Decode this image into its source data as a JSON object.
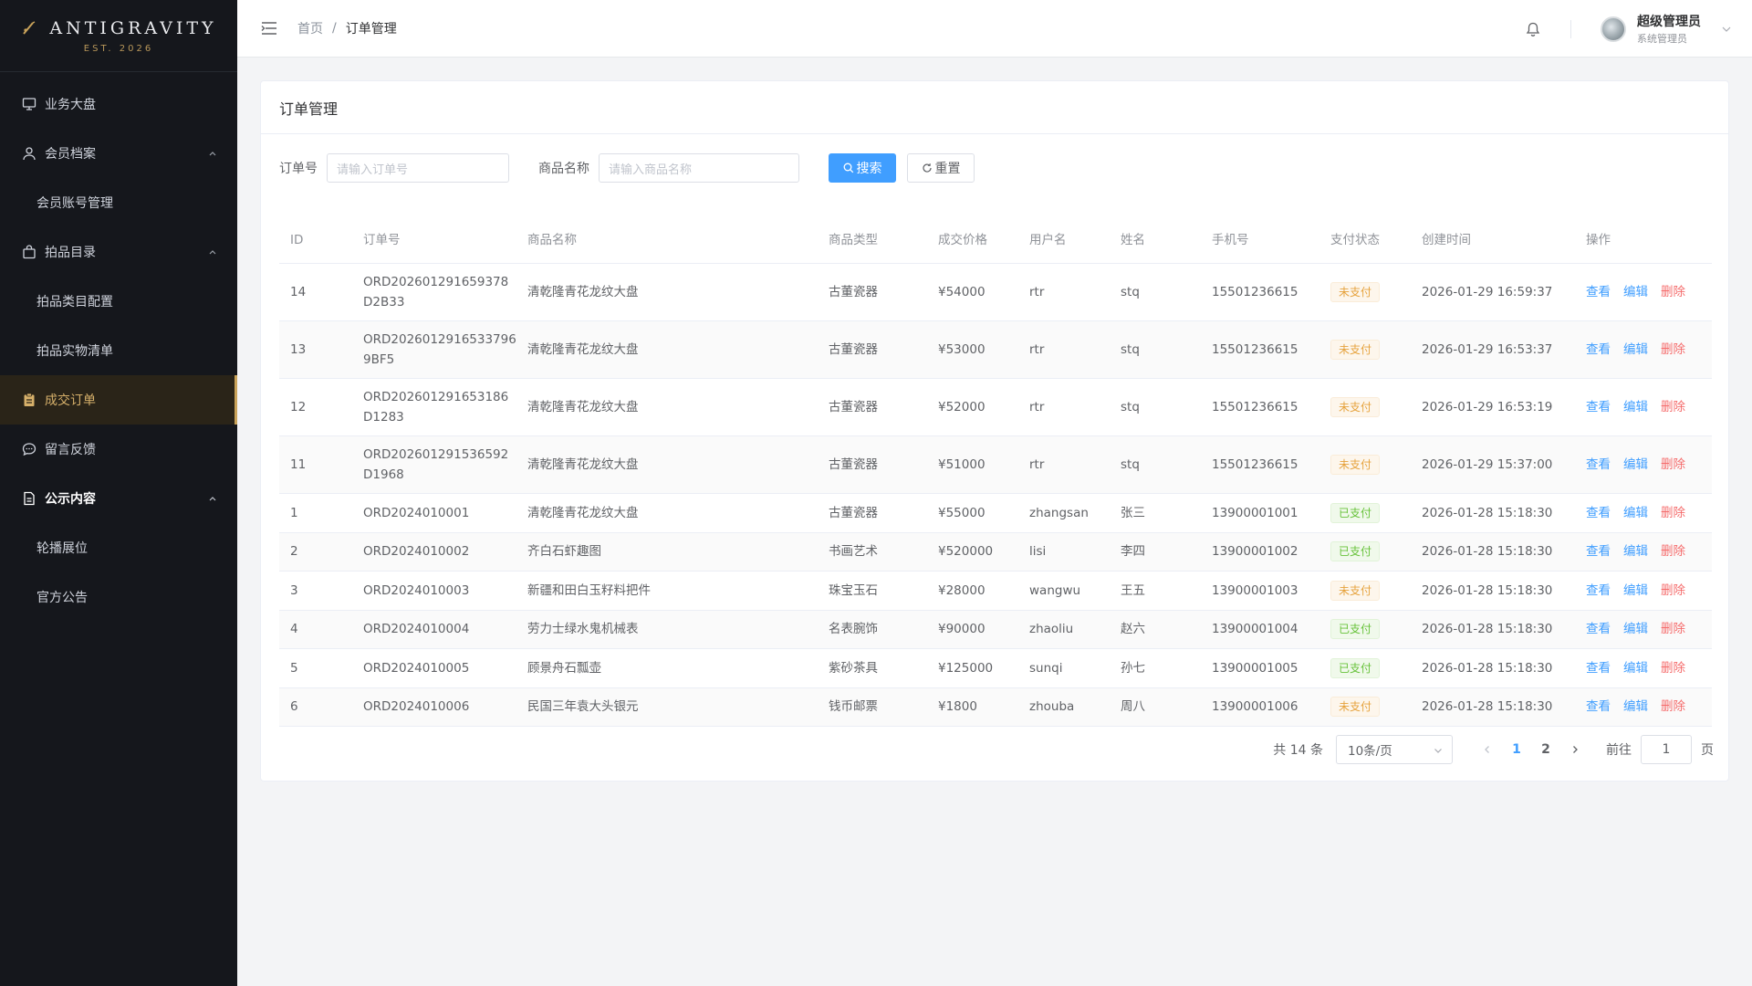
{
  "brand": {
    "name": "ANTIGRAVITY",
    "subtitle": "EST. 2026"
  },
  "sidebar": {
    "items": [
      {
        "label": "业务大盘"
      },
      {
        "label": "会员档案"
      },
      {
        "label": "会员账号管理"
      },
      {
        "label": "拍品目录"
      },
      {
        "label": "拍品类目配置"
      },
      {
        "label": "拍品实物清单"
      },
      {
        "label": "成交订单"
      },
      {
        "label": "留言反馈"
      },
      {
        "label": "公示内容"
      },
      {
        "label": "轮播展位"
      },
      {
        "label": "官方公告"
      }
    ]
  },
  "header": {
    "breadcrumb": {
      "home": "首页",
      "sep": "/",
      "current": "订单管理"
    },
    "user": {
      "name": "超级管理员",
      "role": "系统管理员"
    }
  },
  "card": {
    "title": "订单管理"
  },
  "filters": {
    "order_label": "订单号",
    "order_placeholder": "请输入订单号",
    "product_label": "商品名称",
    "product_placeholder": "请输入商品名称",
    "search_label": "搜索",
    "reset_label": "重置"
  },
  "table": {
    "columns": [
      "ID",
      "订单号",
      "商品名称",
      "商品类型",
      "成交价格",
      "用户名",
      "姓名",
      "手机号",
      "支付状态",
      "创建时间",
      "操作"
    ],
    "ops": {
      "view": "查看",
      "edit": "编辑",
      "delete": "删除"
    },
    "rows": [
      {
        "id": "14",
        "order": "ORD2026012916593 78D2B33",
        "order_display": "ORD202601291659378D2B33",
        "product": "清乾隆青花龙纹大盘",
        "type": "古董瓷器",
        "price": "¥54000",
        "username": "rtr",
        "name": "stq",
        "phone": "15501236615",
        "status": "未支付",
        "paid": false,
        "time": "2026-01-29 16:59:37"
      },
      {
        "id": "13",
        "order": "ORD2026012916533796 9BF5",
        "order_display": "ORD2026012916533796 9BF5",
        "product": "清乾隆青花龙纹大盘",
        "type": "古董瓷器",
        "price": "¥53000",
        "username": "rtr",
        "name": "stq",
        "phone": "15501236615",
        "status": "未支付",
        "paid": false,
        "time": "2026-01-29 16:53:37"
      },
      {
        "id": "12",
        "order": "ORD202601291653186D1283",
        "order_display": "ORD202601291653186D1283",
        "product": "清乾隆青花龙纹大盘",
        "type": "古董瓷器",
        "price": "¥52000",
        "username": "rtr",
        "name": "stq",
        "phone": "15501236615",
        "status": "未支付",
        "paid": false,
        "time": "2026-01-29 16:53:19"
      },
      {
        "id": "11",
        "order": "ORD202601291536592D1968",
        "order_display": "ORD202601291536592D1968",
        "product": "清乾隆青花龙纹大盘",
        "type": "古董瓷器",
        "price": "¥51000",
        "username": "rtr",
        "name": "stq",
        "phone": "15501236615",
        "status": "未支付",
        "paid": false,
        "time": "2026-01-29 15:37:00"
      },
      {
        "id": "1",
        "order_display": "ORD2024010001",
        "product": "清乾隆青花龙纹大盘",
        "type": "古董瓷器",
        "price": "¥55000",
        "username": "zhangsan",
        "name": "张三",
        "phone": "13900001001",
        "status": "已支付",
        "paid": true,
        "time": "2026-01-28 15:18:30"
      },
      {
        "id": "2",
        "order_display": "ORD2024010002",
        "product": "齐白石虾趣图",
        "type": "书画艺术",
        "price": "¥520000",
        "username": "lisi",
        "name": "李四",
        "phone": "13900001002",
        "status": "已支付",
        "paid": true,
        "time": "2026-01-28 15:18:30"
      },
      {
        "id": "3",
        "order_display": "ORD2024010003",
        "product": "新疆和田白玉籽料把件",
        "type": "珠宝玉石",
        "price": "¥28000",
        "username": "wangwu",
        "name": "王五",
        "phone": "13900001003",
        "status": "未支付",
        "paid": false,
        "time": "2026-01-28 15:18:30"
      },
      {
        "id": "4",
        "order_display": "ORD2024010004",
        "product": "劳力士绿水鬼机械表",
        "type": "名表腕饰",
        "price": "¥90000",
        "username": "zhaoliu",
        "name": "赵六",
        "phone": "13900001004",
        "status": "已支付",
        "paid": true,
        "time": "2026-01-28 15:18:30"
      },
      {
        "id": "5",
        "order_display": "ORD2024010005",
        "product": "顾景舟石瓢壶",
        "type": "紫砂茶具",
        "price": "¥125000",
        "username": "sunqi",
        "name": "孙七",
        "phone": "13900001005",
        "status": "已支付",
        "paid": true,
        "time": "2026-01-28 15:18:30"
      },
      {
        "id": "6",
        "order_display": "ORD2024010006",
        "product": "民国三年袁大头银元",
        "type": "钱币邮票",
        "price": "¥1800",
        "username": "zhouba",
        "name": "周八",
        "phone": "13900001006",
        "status": "未支付",
        "paid": false,
        "time": "2026-01-28 15:18:30"
      }
    ]
  },
  "pagination": {
    "total_text": "共 14 条",
    "page_size": "10条/页",
    "pages": [
      "1",
      "2"
    ],
    "current_page": "1",
    "goto_label": "前往",
    "goto_value": "1",
    "page_suffix": "页"
  }
}
